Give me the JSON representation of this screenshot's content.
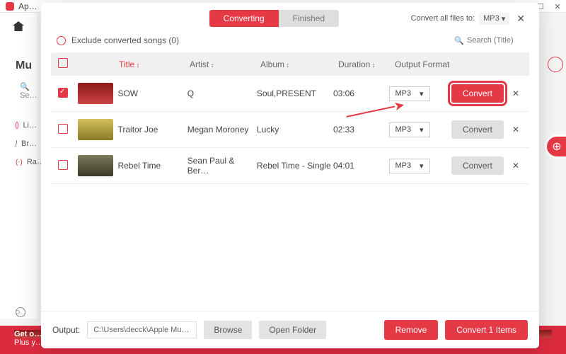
{
  "bg": {
    "app_short": "Ap…",
    "apple_music": "Mu",
    "search_hint": "Se…",
    "nav": {
      "listen": "Li…",
      "browse": "Br…",
      "radio": "Ra…"
    },
    "banner_title": "Get o…",
    "banner_sub": "Plus y…",
    "o_label": "O…"
  },
  "modal": {
    "tabs": {
      "converting": "Converting",
      "finished": "Finished"
    },
    "convert_all_label": "Convert all files to:",
    "convert_all_value": "MP3",
    "exclude_label": "Exclude converted songs (0)",
    "search_placeholder": "Search (Title)",
    "headers": {
      "title": "Title",
      "artist": "Artist",
      "album": "Album",
      "duration": "Duration",
      "output_format": "Output Format"
    },
    "rows": [
      {
        "checked": true,
        "thumb": "t1",
        "title": "SOW",
        "artist": "Q",
        "album": "Soul,PRESENT",
        "duration": "03:06",
        "format": "MP3",
        "highlight": true,
        "btn": "Convert",
        "primary": true
      },
      {
        "checked": false,
        "thumb": "t2",
        "title": "Traitor Joe",
        "artist": "Megan Moroney",
        "album": "Lucky",
        "duration": "02:33",
        "format": "MP3",
        "highlight": false,
        "btn": "Convert",
        "primary": false
      },
      {
        "checked": false,
        "thumb": "t3",
        "title": "Rebel Time",
        "artist": "Sean Paul & Ber…",
        "album": "Rebel Time - Single",
        "duration": "04:01",
        "format": "MP3",
        "highlight": false,
        "btn": "Convert",
        "primary": false
      }
    ],
    "footer": {
      "output_label": "Output:",
      "output_path": "C:\\Users\\decck\\Apple Music…",
      "browse": "Browse",
      "open_folder": "Open Folder",
      "remove": "Remove",
      "convert_items": "Convert 1 Items"
    }
  }
}
